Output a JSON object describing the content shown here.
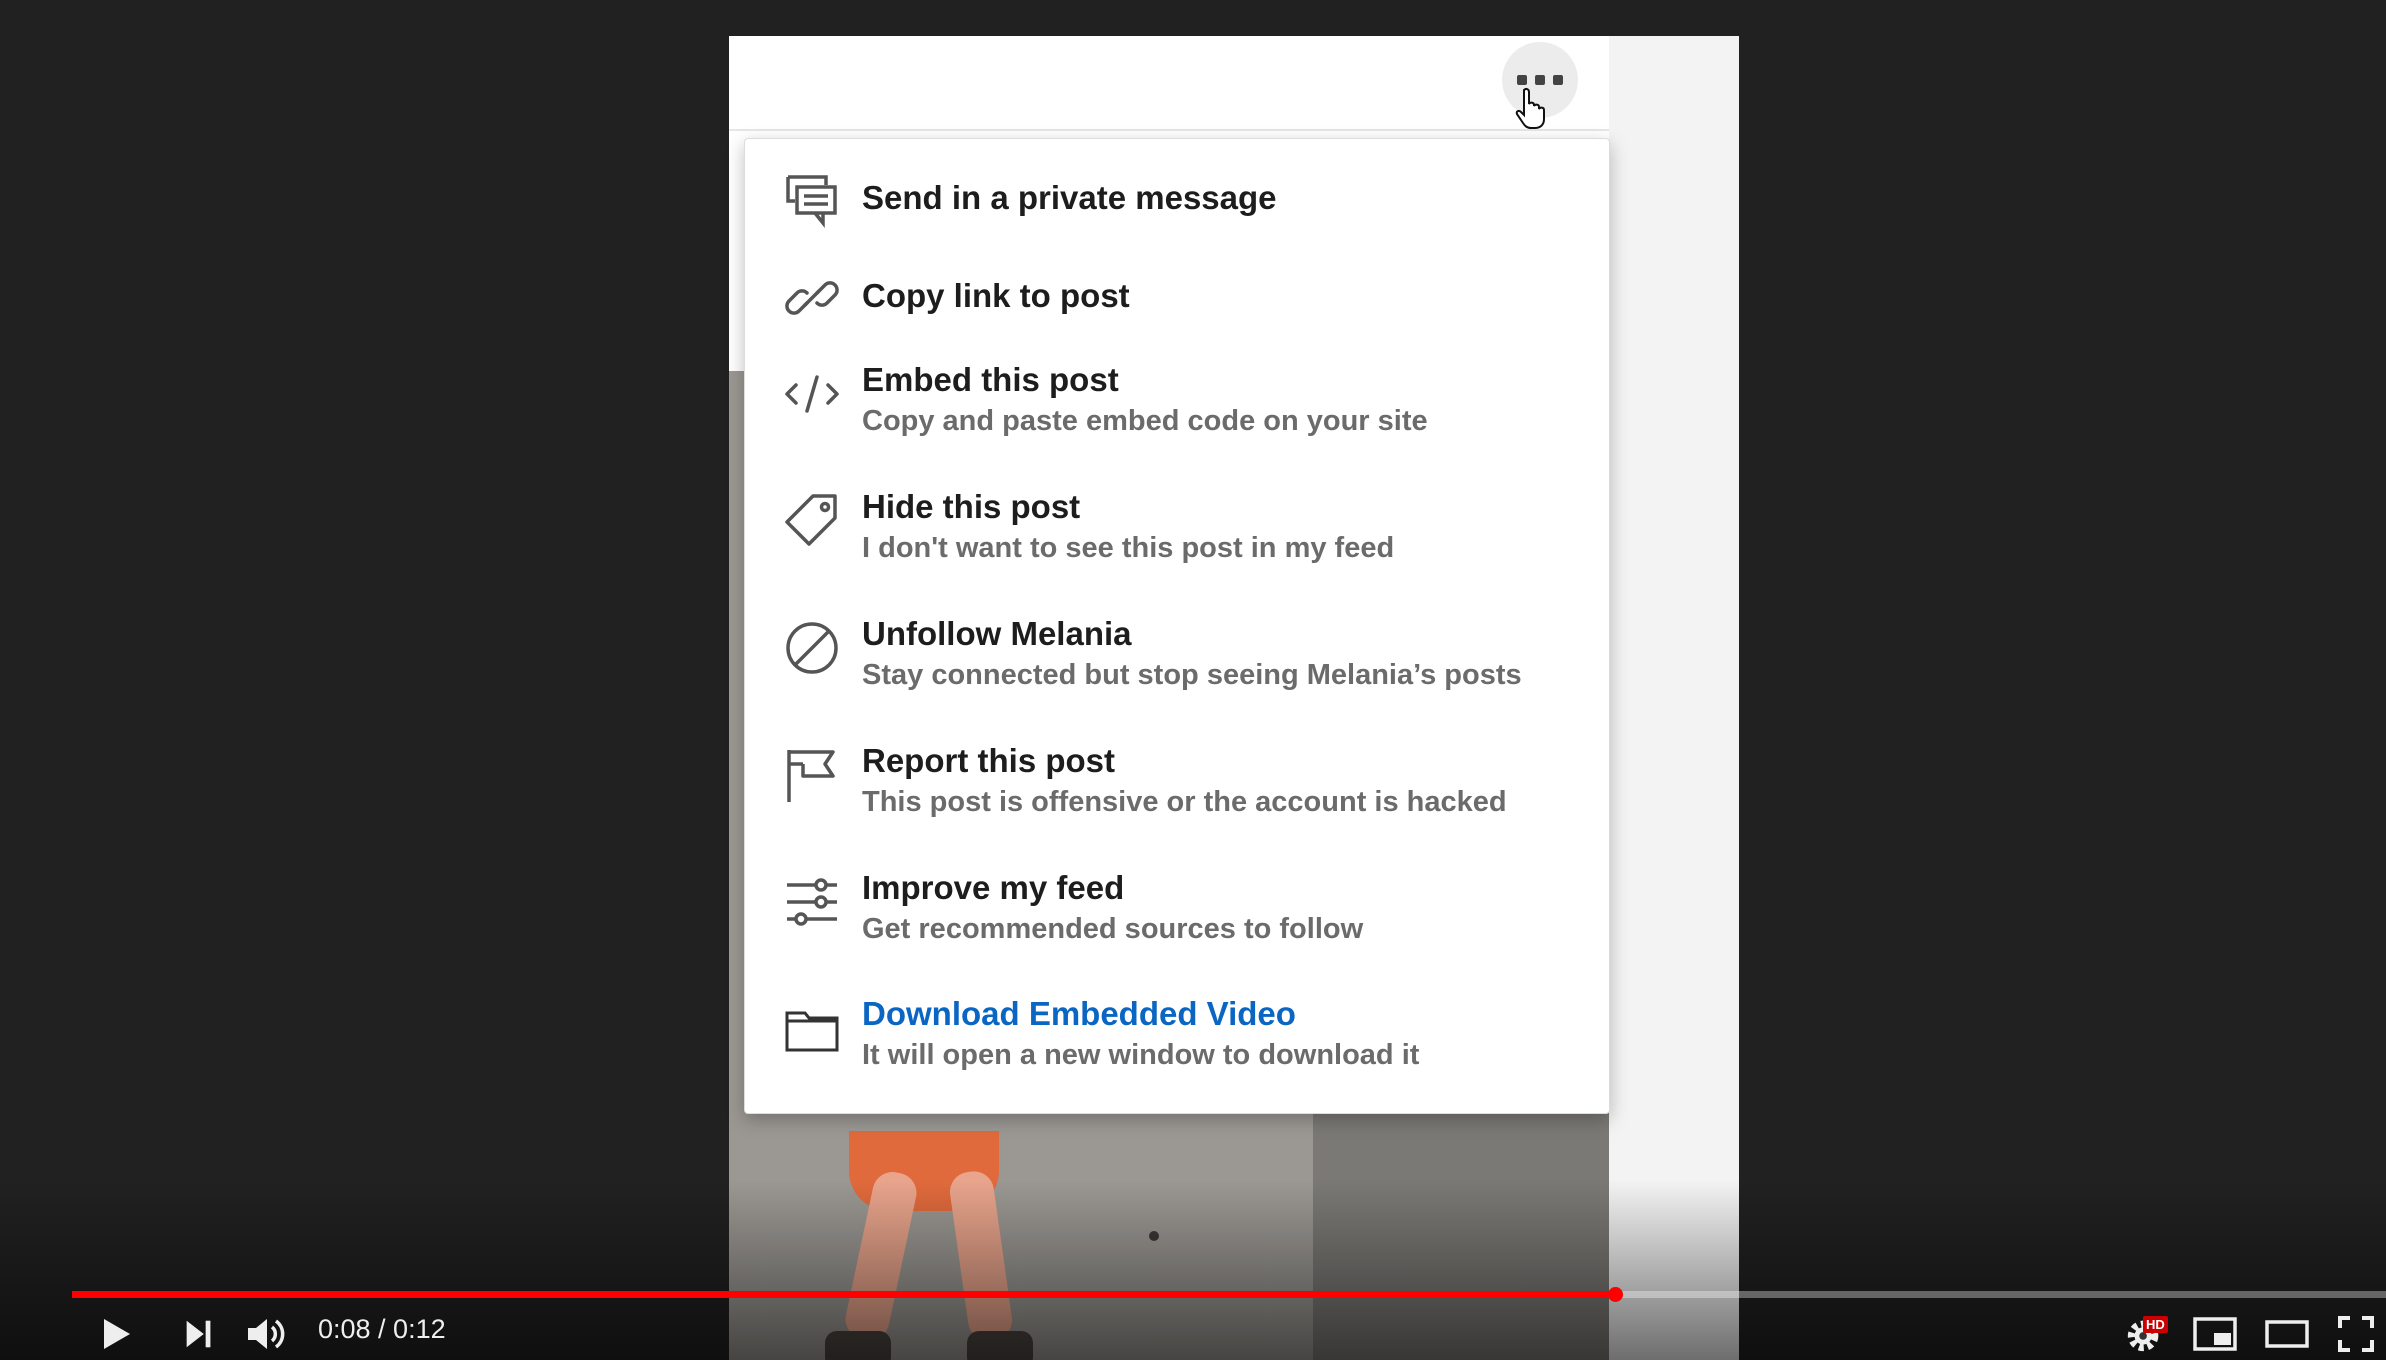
{
  "menu": {
    "items": [
      {
        "icon": "message-icon",
        "title": "Send in a private message",
        "subtitle": ""
      },
      {
        "icon": "link-icon",
        "title": "Copy link to post",
        "subtitle": ""
      },
      {
        "icon": "code-icon",
        "title": "Embed this post",
        "subtitle": "Copy and paste embed code on your site"
      },
      {
        "icon": "tag-icon",
        "title": "Hide this post",
        "subtitle": "I don't want to see this post in my feed"
      },
      {
        "icon": "block-icon",
        "title": "Unfollow Melania",
        "subtitle": "Stay connected but stop seeing Melania’s posts"
      },
      {
        "icon": "flag-icon",
        "title": "Report this post",
        "subtitle": "This post is offensive or the account is hacked"
      },
      {
        "icon": "sliders-icon",
        "title": "Improve my feed",
        "subtitle": "Get recommended sources to follow"
      },
      {
        "icon": "folder-icon",
        "title": "Download Embedded Video",
        "subtitle": "It will open a new window to download it"
      }
    ]
  },
  "player": {
    "current_time": "0:08",
    "duration": "0:12",
    "time_text": "0:08 / 0:12",
    "progress_fraction": 0.667,
    "hd_label": "HD",
    "accent_color": "#ff0000"
  },
  "colors": {
    "link": "#0a66c2",
    "title": "#1d1d1d",
    "subtitle": "#6b6b6b"
  }
}
